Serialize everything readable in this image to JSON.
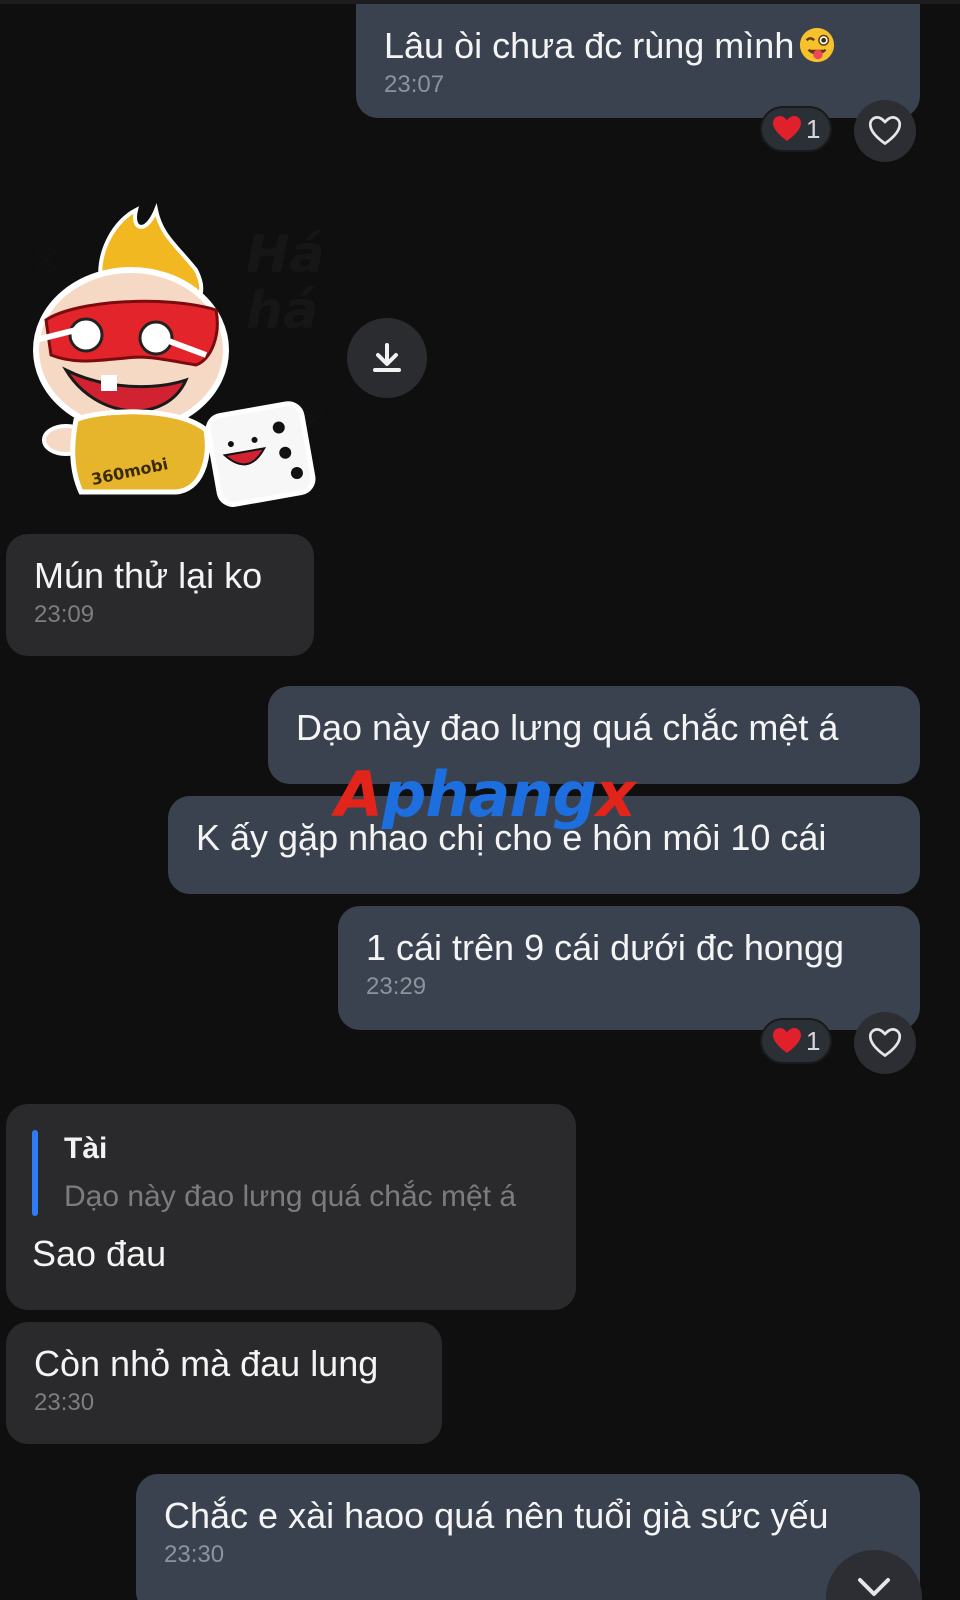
{
  "messages": [
    {
      "id": "m1",
      "direction": "outgoing",
      "text": "Lâu òi chưa đc rùng mình",
      "emoji": "winking-face-with-tongue",
      "time": "23:07",
      "reaction": {
        "emoji": "❤️",
        "count": "1"
      }
    },
    {
      "id": "m2",
      "direction": "incoming",
      "type": "sticker",
      "sticker": {
        "caption_lines": [
          "Há",
          "há"
        ],
        "brand": "360mobi"
      }
    },
    {
      "id": "m3",
      "direction": "incoming",
      "text": "Mún thử lại ko",
      "time": "23:09"
    },
    {
      "id": "m4",
      "direction": "outgoing",
      "text": "Dạo này đao lưng quá chắc mệt á"
    },
    {
      "id": "m5",
      "direction": "outgoing",
      "text": "K ấy gặp nhao chị cho e hôn môi 10 cái"
    },
    {
      "id": "m6",
      "direction": "outgoing",
      "text": "1 cái trên 9 cái dưới đc hongg",
      "time": "23:29",
      "reaction": {
        "emoji": "❤️",
        "count": "1"
      }
    },
    {
      "id": "m7",
      "direction": "incoming",
      "quote": {
        "name": "Tài",
        "text": "Dạo này đao lưng quá chắc mệt á"
      },
      "text": "Sao đau"
    },
    {
      "id": "m8",
      "direction": "incoming",
      "text": "Còn nhỏ mà đau lung",
      "time": "23:30"
    },
    {
      "id": "m9",
      "direction": "outgoing",
      "text": "Chắc e xài haoo quá nên tuổi già sức yếu",
      "time": "23:30"
    }
  ],
  "watermark": {
    "a": "A",
    "mid": "phang",
    "x": "x"
  },
  "colors": {
    "outgoing_bubble": "#3a4250",
    "incoming_bubble": "#2a2a2c",
    "background": "#0f0f10",
    "quote_bar": "#2f7df6",
    "heart": "#e0202a"
  },
  "icons": {
    "download": "download-icon",
    "like": "heart-outline-icon",
    "scroll": "chevron-down-icon"
  }
}
